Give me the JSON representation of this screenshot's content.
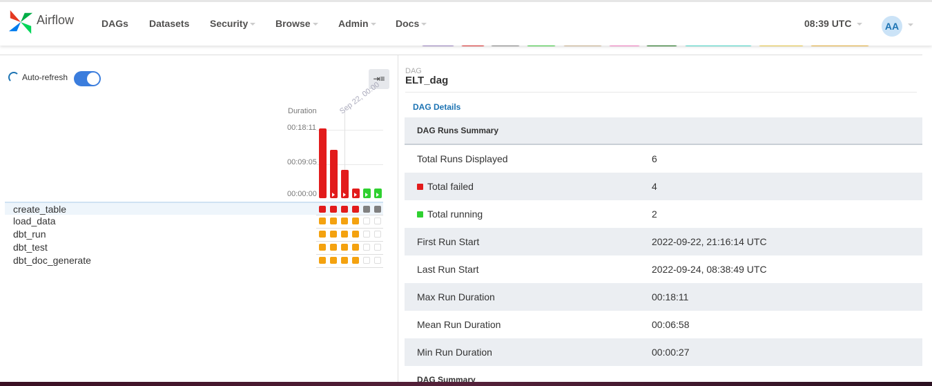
{
  "app": {
    "brand": "Airflow",
    "logo_icon": "airflow-pinwheel-icon"
  },
  "nav": {
    "items": [
      {
        "label": "DAGs",
        "dropdown": false
      },
      {
        "label": "Datasets",
        "dropdown": false
      },
      {
        "label": "Security",
        "dropdown": true
      },
      {
        "label": "Browse",
        "dropdown": true
      },
      {
        "label": "Admin",
        "dropdown": true
      },
      {
        "label": "Docs",
        "dropdown": true
      }
    ],
    "time": "08:39 UTC",
    "user_initials": "AA"
  },
  "legend_colors": [
    "#9b7fc4",
    "#e21b1b",
    "#808080",
    "#2fd030",
    "#d2b48c",
    "#ff79c6",
    "#006400",
    "#40e0d0",
    "#f4d03f",
    "#f0b32e"
  ],
  "grid": {
    "auto_refresh_label": "Auto-refresh",
    "auto_refresh_on": true,
    "collapse_icon": "collapse-arrow-icon",
    "duration_label": "Duration",
    "y_ticks": [
      "00:18:11",
      "00:09:05",
      "00:00:00"
    ],
    "date_label": "Sep 22, 00:00",
    "runs": [
      {
        "state": "failed",
        "duration_fraction": 1.0
      },
      {
        "state": "failed",
        "duration_fraction": 0.69
      },
      {
        "state": "failed",
        "duration_fraction": 0.41
      },
      {
        "state": "failed",
        "duration_fraction": 0.14
      },
      {
        "state": "running",
        "duration_fraction": 0.14
      },
      {
        "state": "running",
        "duration_fraction": 0.14
      }
    ],
    "tasks": [
      {
        "name": "create_table",
        "states": [
          "failed",
          "failed",
          "failed",
          "failed",
          "queued",
          "queued"
        ]
      },
      {
        "name": "load_data",
        "states": [
          "upstream_failed",
          "upstream_failed",
          "upstream_failed",
          "upstream_failed",
          "none",
          "none"
        ]
      },
      {
        "name": "dbt_run",
        "states": [
          "upstream_failed",
          "upstream_failed",
          "upstream_failed",
          "upstream_failed",
          "none",
          "none"
        ]
      },
      {
        "name": "dbt_test",
        "states": [
          "upstream_failed",
          "upstream_failed",
          "upstream_failed",
          "upstream_failed",
          "none",
          "none"
        ]
      },
      {
        "name": "dbt_doc_generate",
        "states": [
          "upstream_failed",
          "upstream_failed",
          "upstream_failed",
          "upstream_failed",
          "none",
          "none"
        ]
      }
    ],
    "state_colors": {
      "failed": "#e21b1b",
      "running": "#2fd030",
      "queued": "#808080",
      "upstream_failed": "#f4a20f",
      "none": "#ffffff"
    }
  },
  "details": {
    "kicker": "DAG",
    "dag_id": "ELT_dag",
    "details_link": "DAG Details",
    "runs_summary_title": "DAG Runs Summary",
    "rows": [
      {
        "key": "Total Runs Displayed",
        "value": "6"
      },
      {
        "key": "Total failed",
        "value": "4",
        "swatch": "#e21b1b"
      },
      {
        "key": "Total running",
        "value": "2",
        "swatch": "#2fd030"
      },
      {
        "key": "First Run Start",
        "value": "2022-09-22, 21:16:14 UTC"
      },
      {
        "key": "Last Run Start",
        "value": "2022-09-24, 08:38:49 UTC"
      },
      {
        "key": "Max Run Duration",
        "value": "00:18:11"
      },
      {
        "key": "Mean Run Duration",
        "value": "00:06:58"
      },
      {
        "key": "Min Run Duration",
        "value": "00:00:27"
      }
    ],
    "dag_summary_title": "DAG Summary"
  }
}
